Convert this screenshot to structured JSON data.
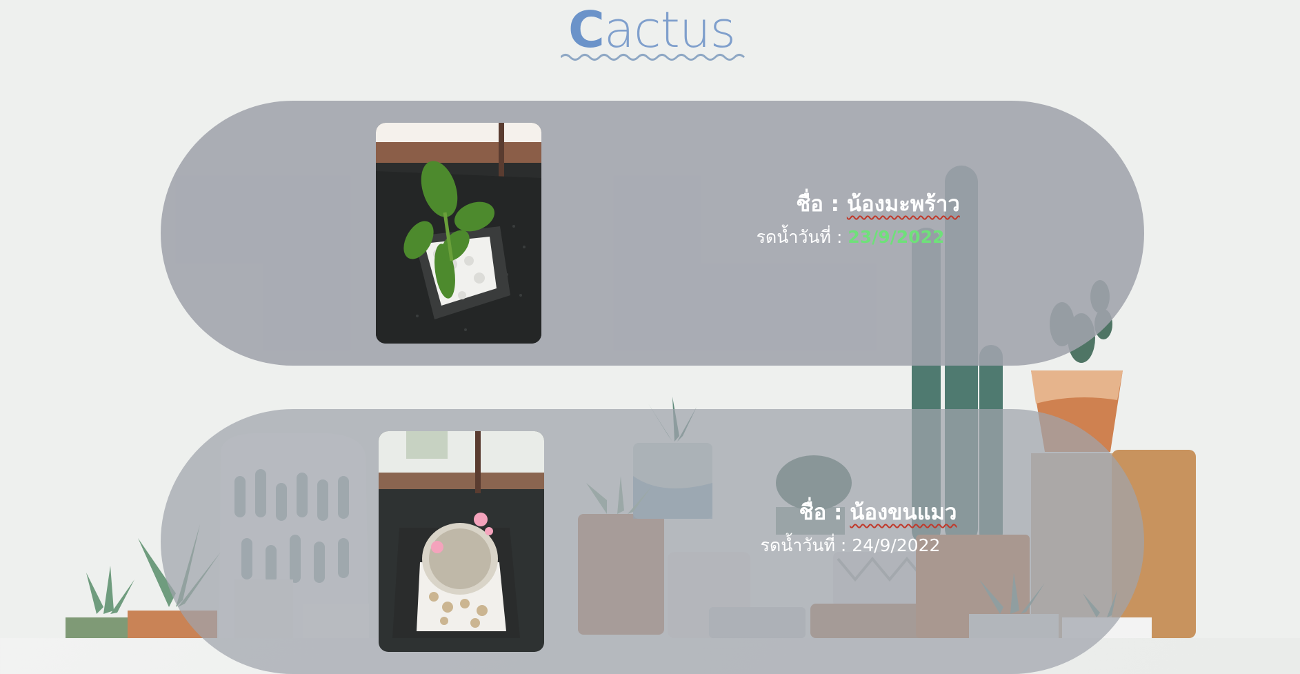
{
  "header": {
    "title_first": "C",
    "title_rest": "actus"
  },
  "plants": [
    {
      "name_label": "ชื่อ : ",
      "name": "น้องมะพร้าว",
      "water_label": "รดน้ำวันที่ : ",
      "water_date": "23/9/2022"
    },
    {
      "name_label": "ชื่อ : ",
      "name": "น้องขนแมว",
      "water_label": "รดน้ำวันที่ : ",
      "water_date": "24/9/2022"
    }
  ],
  "colors": {
    "title": "#7f9fcc",
    "card_bg": "#a3a6ae",
    "date_highlight": "#6fe07a",
    "name_underline": "#c0392b"
  },
  "icons": [
    "plant-photo-seedling",
    "plant-photo-cactus"
  ]
}
